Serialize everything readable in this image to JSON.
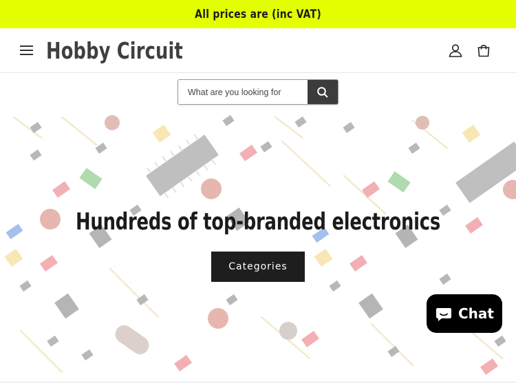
{
  "announcement": {
    "text": "All prices are (inc VAT)",
    "background": "#e4ff00"
  },
  "header": {
    "logo_text": "Hobby Circuit",
    "menu_icon": "hamburger-menu-icon",
    "account_icon": "account-icon",
    "cart_icon": "cart-icon"
  },
  "search": {
    "placeholder": "What are you looking for",
    "value": "",
    "icon": "search-icon"
  },
  "hero": {
    "title": "Hundreds of top-branded electronics",
    "button_label": "Categories",
    "background_pattern": "electronic-components-pattern"
  },
  "chat": {
    "label": "Chat",
    "icon": "chat-bubble-icon",
    "background": "#000000"
  }
}
